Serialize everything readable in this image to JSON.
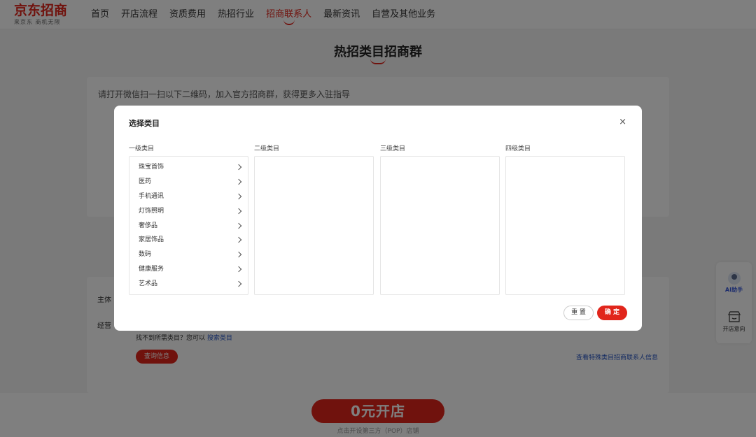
{
  "header": {
    "logo_main": "京东招商",
    "logo_sub": "来京东 商机无限",
    "nav": [
      {
        "label": "首页"
      },
      {
        "label": "开店流程"
      },
      {
        "label": "资质费用"
      },
      {
        "label": "热招行业"
      },
      {
        "label": "招商联系人"
      },
      {
        "label": "最新资讯"
      },
      {
        "label": "自营及其他业务"
      }
    ],
    "active_nav": "招商联系人"
  },
  "section": {
    "title": "热招类目招商群",
    "hint": "请打开微信扫一扫以下二维码，加入官方招商群，获得更多入驻指导"
  },
  "form": {
    "subject_label": "主体",
    "scope_label": "经营",
    "tip_text": "找不到所需类目？您可以",
    "tip_link": "搜索类目",
    "query_button": "查询信息",
    "contact_link": "查看特殊类目招商联系人信息"
  },
  "bottom": {
    "open_button": "0元开店",
    "open_sub": "点击开设第三方（POP）店铺"
  },
  "float_widget": {
    "ai_label": "AI助手",
    "shop_label": "开店意向"
  },
  "modal": {
    "title": "选择类目",
    "close": "×",
    "columns": [
      "一级类目",
      "二级类目",
      "三级类目",
      "四级类目"
    ],
    "level1_items": [
      "珠宝首饰",
      "医药",
      "手机通讯",
      "灯饰照明",
      "奢侈品",
      "家居饰品",
      "数码",
      "健康服务",
      "艺术品"
    ],
    "reset_button": "重 置",
    "ok_button": "确 定"
  },
  "colors": {
    "brand": "#e1251b",
    "link": "#2957c4"
  }
}
